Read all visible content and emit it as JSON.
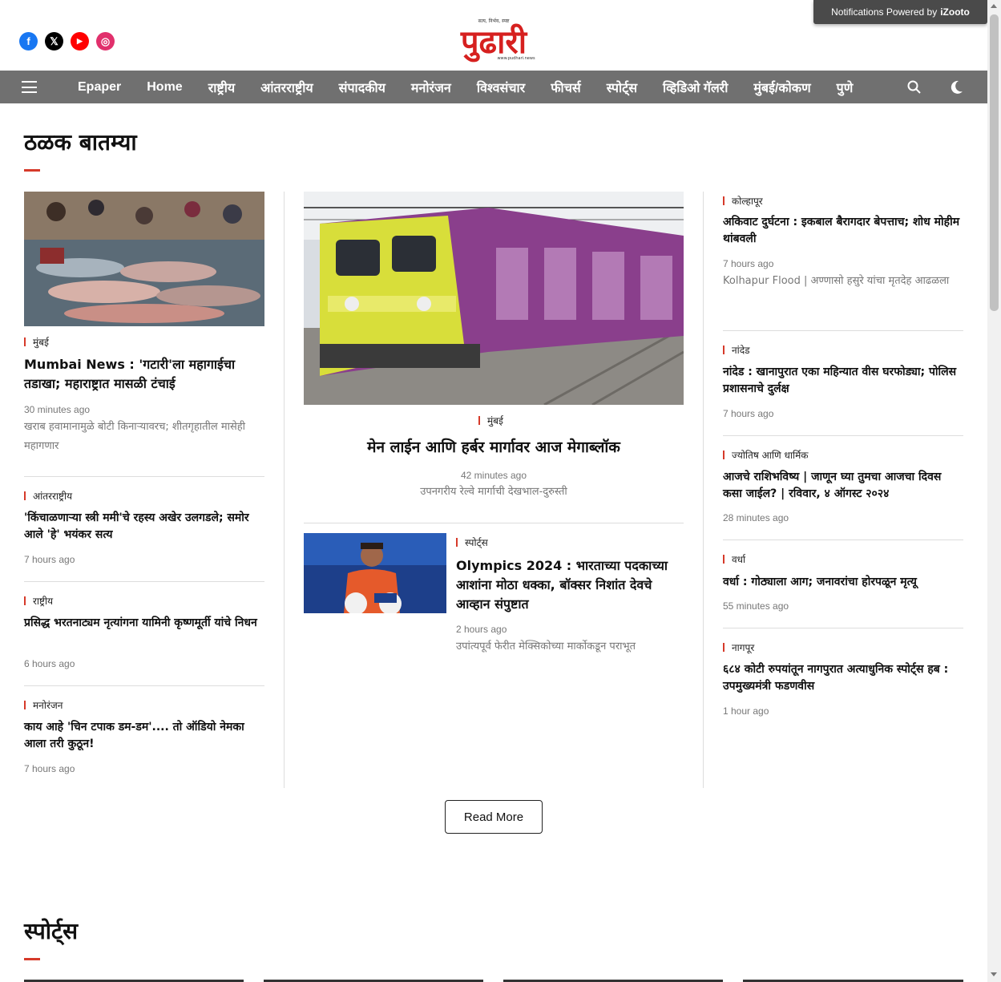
{
  "header": {
    "notification_text": "Notifications Powered by",
    "notification_brand": "iZooto",
    "logo_text": "पुढारी",
    "logo_tagline": "सत्य, निर्भय, स्पष्ट",
    "logo_url_text": "www.pudhari.news",
    "social": [
      {
        "name": "facebook-icon",
        "glyph": "f",
        "color": "#1877f2"
      },
      {
        "name": "x-icon",
        "glyph": "𝕏",
        "color": "#000000"
      },
      {
        "name": "youtube-icon",
        "glyph": "▶",
        "color": "#ff0000"
      },
      {
        "name": "instagram-icon",
        "glyph": "◎",
        "color": "#e1306c"
      }
    ]
  },
  "nav": {
    "items": [
      "Epaper",
      "Home",
      "राष्ट्रीय",
      "आंतरराष्ट्रीय",
      "संपादकीय",
      "मनोरंजन",
      "विश्वसंचार",
      "फीचर्स",
      "स्पोर्ट्स",
      "व्हिडिओ गॅलरी",
      "मुंबई/कोकण",
      "पुणे"
    ]
  },
  "section1": {
    "title": "ठळक बातम्या",
    "left": [
      {
        "category": "मुंबई",
        "headline": "Mumbai News : 'गटारी'ला महागाईचा तडाखा; महाराष्ट्रात मासळी टंचाई",
        "time": "30 minutes ago",
        "summary": "खराब हवामानामुळे बोटी किनाऱ्यावरच; शीतगृहातील मासेही महागणार"
      },
      {
        "category": "आंतरराष्ट्रीय",
        "headline": "'किंचाळणाऱ्या स्त्री ममी'चे रहस्य अखेर उलगडले; समोर आले 'हे' भयंकर सत्य",
        "time": "7 hours ago"
      },
      {
        "category": "राष्ट्रीय",
        "headline": "प्रसिद्ध भरतनाट्यम नृत्यांगना यामिनी कृष्णमूर्ती यांचे निधन",
        "time": "6 hours ago"
      },
      {
        "category": "मनोरंजन",
        "headline": "काय आहे 'चिन टपाक डम-डम'.... तो ऑडियो नेमका आला तरी कुठून!",
        "time": "7 hours ago"
      }
    ],
    "center": {
      "category": "मुंबई",
      "headline": "मेन लाईन आणि हर्बर मार्गावर आज मेगाब्लॉक",
      "time": "42 minutes ago",
      "summary": "उपनगरीय रेल्वे मार्गाची देखभाल-दुरुस्ती",
      "second": {
        "category": "स्पोर्ट्स",
        "headline": "Olympics 2024 : भारताच्या पदकाच्या आशांना मोठा धक्का, बॉक्सर निशांत देवचे आव्हान संपुष्टात",
        "time": "2 hours ago",
        "summary": "उपांत्यपूर्व फेरीत मेक्सिकोच्या मार्कोकडून पराभूत"
      }
    },
    "right": [
      {
        "category": "कोल्हापूर",
        "headline": "अकिवाट दुर्घटना : इकबाल बैरागदार बेपत्ताच; शोध मोहीम थांबवली",
        "time": "7 hours ago",
        "summary": "Kolhapur Flood | अण्णासो हसुरे यांचा मृतदेह आढळला"
      },
      {
        "category": "नांदेड",
        "headline": "नांदेड : खानापुरात एका महिन्यात वीस घरफोड्या; पोलिस प्रशासनाचे दुर्लक्ष",
        "time": "7 hours ago"
      },
      {
        "category": "ज्योतिष आणि धार्मिक",
        "headline": "आजचे राशिभविष्य | जाणून घ्या तुमचा आजचा दिवस कसा जाईल? | रविवार, ४ ऑगस्ट २०२४",
        "time": "28 minutes ago"
      },
      {
        "category": "वर्धा",
        "headline": "वर्धा : गोठ्याला आग; जनावरांचा होरपळून मृत्यू",
        "time": "55 minutes ago"
      },
      {
        "category": "नागपूर",
        "headline": "६८४ कोटी रुपयांतून नागपुरात अत्याधुनिक स्पोर्ट्स हब : उपमुख्यमंत्री फडणवीस",
        "time": "1 hour ago"
      }
    ],
    "read_more": "Read More"
  },
  "section2": {
    "title": "स्पोर्ट्स"
  }
}
